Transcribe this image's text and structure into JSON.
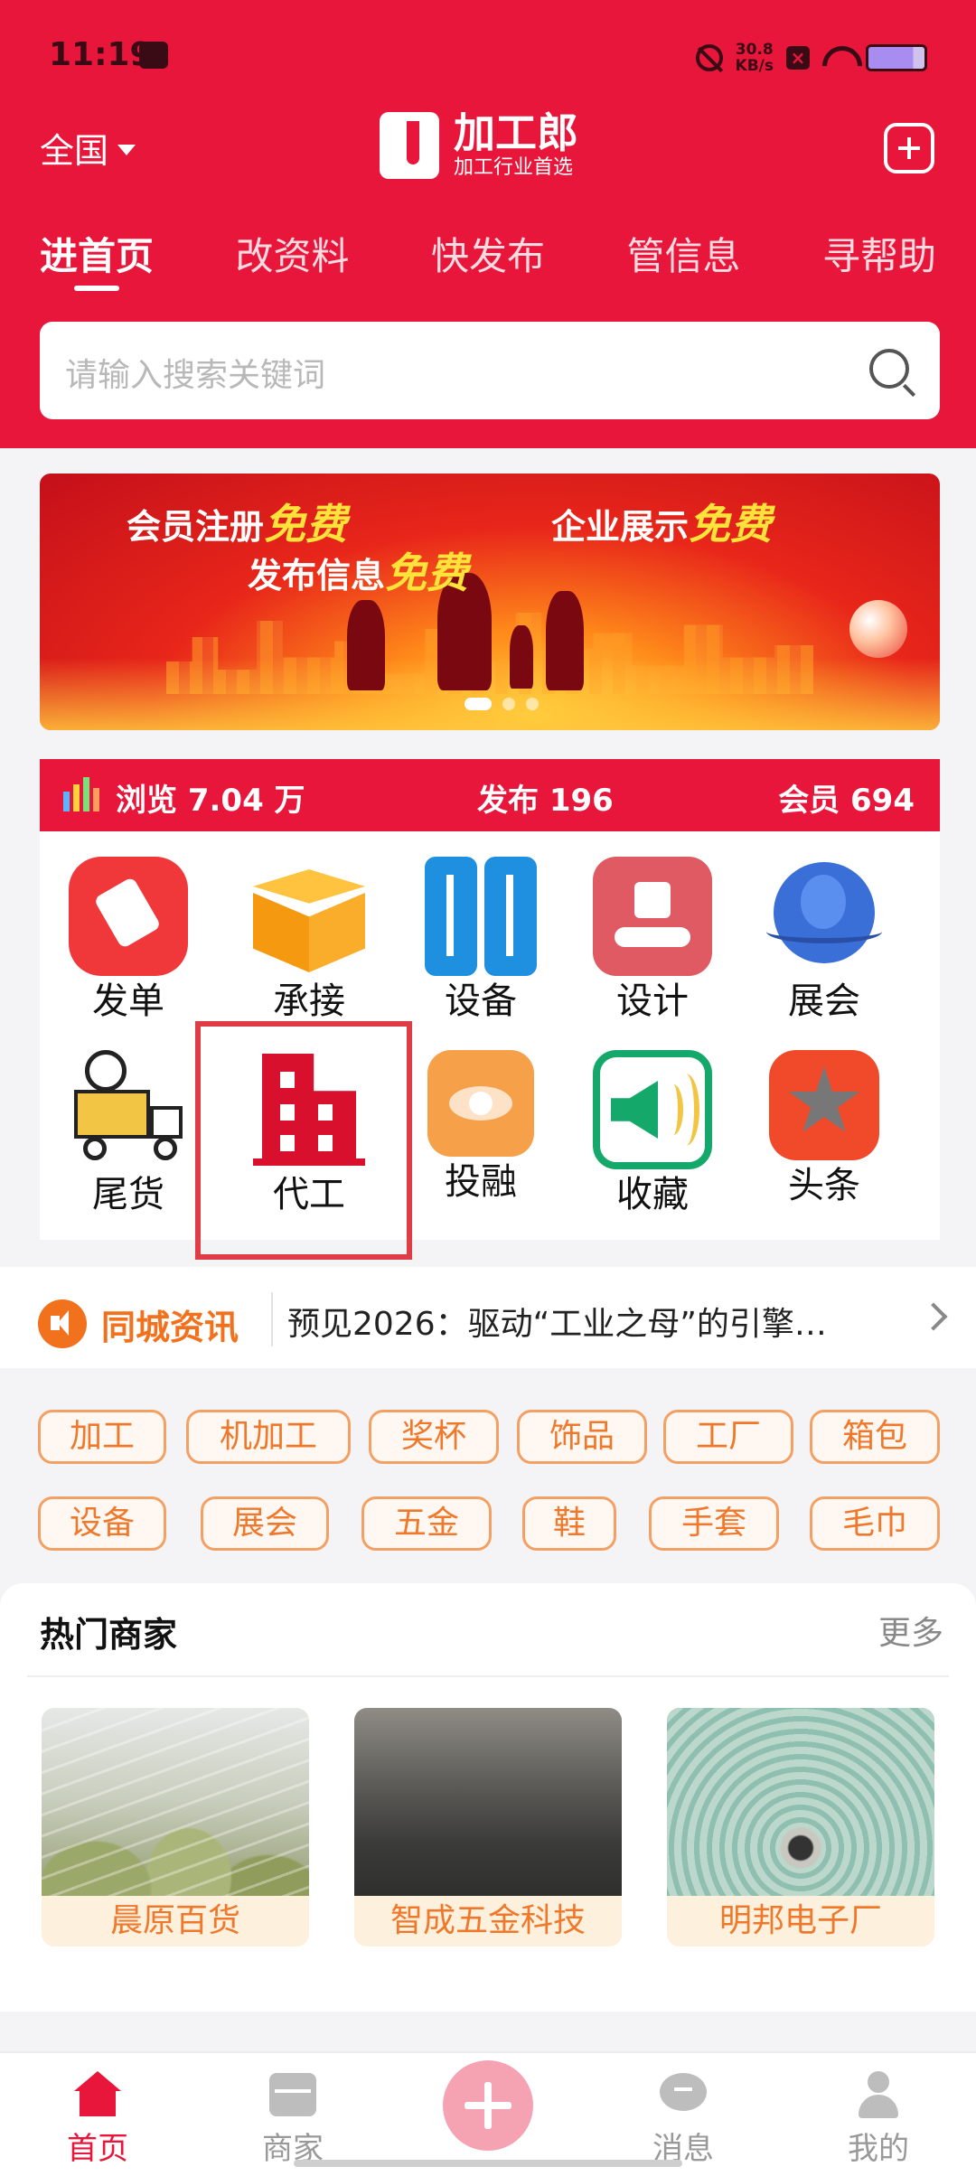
{
  "status": {
    "time": "11:19",
    "speed_top": "30.8",
    "speed_bottom": "KB/s"
  },
  "header": {
    "region": "全国",
    "logo_title": "加工郎",
    "logo_subtitle": "加工行业首选",
    "tabs": [
      {
        "label": "进首页",
        "active": true
      },
      {
        "label": "改资料"
      },
      {
        "label": "快发布"
      },
      {
        "label": "管信息"
      },
      {
        "label": "寻帮助"
      }
    ],
    "search_placeholder": "请输入搜索关键词"
  },
  "banner": {
    "line1_a": "会员注册",
    "line1_a_hl": "免费",
    "line1_b": "企业展示",
    "line1_b_hl": "免费",
    "line2": "发布信息",
    "line2_hl": "免费"
  },
  "stats": {
    "views": "浏览 7.04 万",
    "published": "发布 196",
    "members": "会员 694"
  },
  "grid": [
    {
      "label": "发单",
      "icon": "pencil-icon",
      "color": "#f0383a"
    },
    {
      "label": "承接",
      "icon": "box-icon",
      "color": "#f9a21a"
    },
    {
      "label": "设备",
      "icon": "cabinet-icon",
      "color": "#1f8fe0"
    },
    {
      "label": "设计",
      "icon": "hand-box-icon",
      "color": "#e05a64"
    },
    {
      "label": "展会",
      "icon": "globe-icon",
      "color": "#3a6fd8"
    },
    {
      "label": "尾货",
      "icon": "truck-icon",
      "color": "#f3c544"
    },
    {
      "label": "代工",
      "icon": "building-icon",
      "color": "#d8102e"
    },
    {
      "label": "投融",
      "icon": "eye-icon",
      "color": "#f7a04a"
    },
    {
      "label": "收藏",
      "icon": "speaker-icon",
      "color": "#14a86a"
    },
    {
      "label": "头条",
      "icon": "star-icon",
      "color": "#f04a2a"
    }
  ],
  "news": {
    "tag": "同城资讯",
    "text": "预见2026：驱动“工业之母”的引擎…"
  },
  "chips": [
    "加工",
    "机加工",
    "奖杯",
    "饰品",
    "工厂",
    "箱包",
    "设备",
    "展会",
    "五金",
    "鞋",
    "手套",
    "毛巾"
  ],
  "hot": {
    "title": "热门商家",
    "more": "更多",
    "cards": [
      {
        "name": "晨原百货"
      },
      {
        "name": "智成五金科技"
      },
      {
        "name": "明邦电子厂"
      }
    ]
  },
  "bottom_nav": [
    {
      "label": "首页",
      "active": true
    },
    {
      "label": "商家"
    },
    {
      "label": "消息"
    },
    {
      "label": "我的"
    }
  ]
}
